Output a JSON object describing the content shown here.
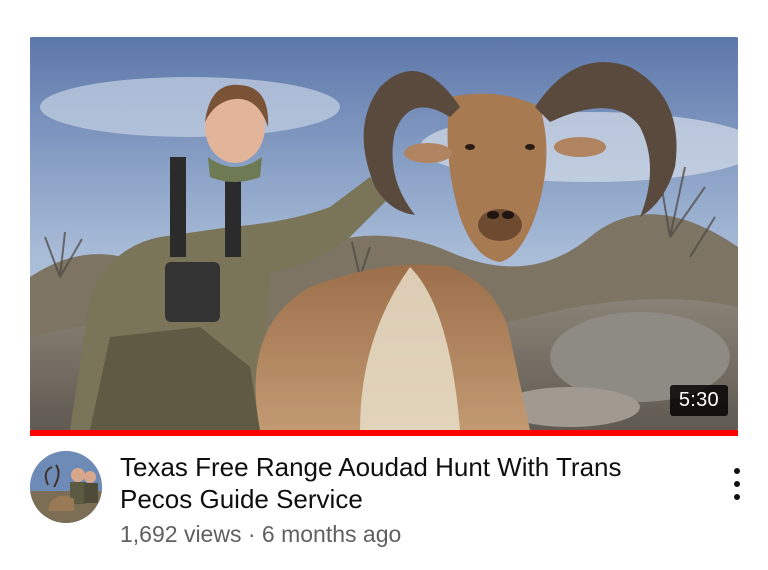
{
  "video": {
    "title": "Texas Free Range Aoudad Hunt With Trans Pecos Guide Service",
    "duration": "5:30",
    "views": "1,692 views",
    "separator": "·",
    "age": "6 months ago",
    "watch_progress": 1.0,
    "progress_color": "#ff0000"
  },
  "icons": {
    "more": "more-vert-icon"
  }
}
